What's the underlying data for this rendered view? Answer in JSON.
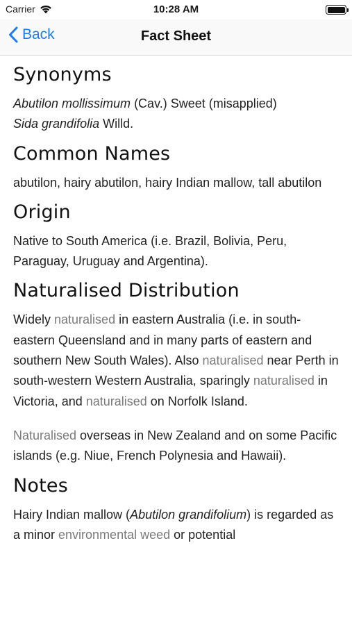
{
  "status": {
    "carrier": "Carrier",
    "time": "10:28 AM"
  },
  "nav": {
    "back_label": "Back",
    "title": "Fact Sheet"
  },
  "synonyms": {
    "heading": "Synonyms",
    "line1_italic": "Abutilon mollissimum",
    "line1_rest": " (Cav.) Sweet (misapplied)",
    "line2_italic": "Sida grandifolia",
    "line2_rest": " Willd."
  },
  "common_names": {
    "heading": "Common Names",
    "text": "abutilon, hairy abutilon, hairy Indian mallow, tall abutilon"
  },
  "origin": {
    "heading": "Origin",
    "text": "Native to South America (i.e. Brazil, Bolivia, Peru, Paraguay, Uruguay and Argentina)."
  },
  "naturalised_distribution": {
    "heading": "Naturalised Distribution",
    "p1": {
      "a": "Widely ",
      "link1": "naturalised",
      "b": " in eastern Australia (i.e. in south-eastern Queensland and in many parts of eastern and southern New South Wales). Also ",
      "link2": "naturalised",
      "c": " near Perth in south-western Western Australia, sparingly ",
      "link3": "naturalised",
      "d": " in Victoria, and ",
      "link4": "naturalised",
      "e": " on Norfolk Island."
    },
    "p2": {
      "link1": "Naturalised",
      "a": " overseas in New Zealand and on some Pacific islands (e.g. Niue, French Polynesia and Hawaii)."
    }
  },
  "notes": {
    "heading": "Notes",
    "a": "Hairy Indian mallow (",
    "italic": "Abutilon grandifolium",
    "b": ") is regarded as a minor ",
    "link1": "environmental weed",
    "c": " or potential"
  }
}
